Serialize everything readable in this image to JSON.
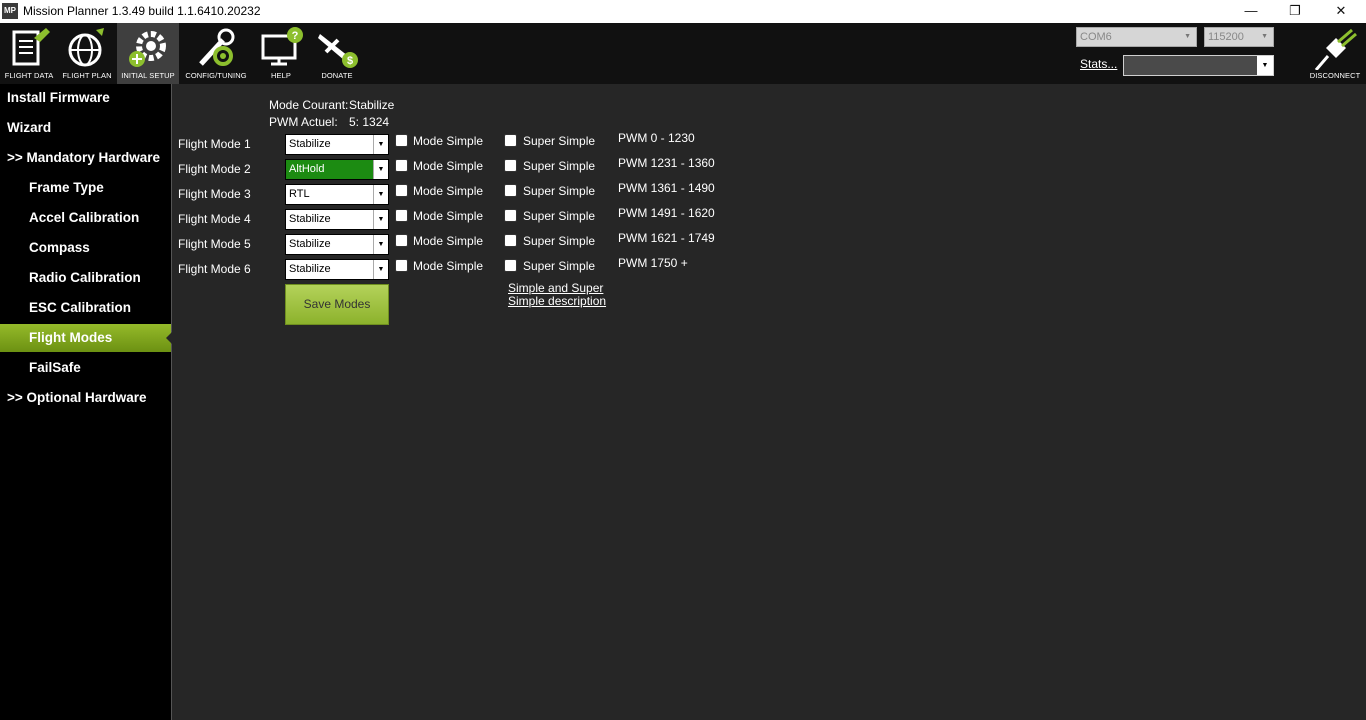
{
  "window": {
    "title": "Mission Planner 1.3.49 build 1.1.6410.20232",
    "app_icon_text": "MP",
    "minimize": "—",
    "restore": "❐",
    "close": "✕"
  },
  "toolbar": {
    "items": [
      {
        "label": "FLIGHT DATA",
        "icon": "flight-data-icon"
      },
      {
        "label": "FLIGHT PLAN",
        "icon": "flight-plan-icon"
      },
      {
        "label": "INITIAL SETUP",
        "icon": "initial-setup-icon",
        "active": true
      },
      {
        "label": "CONFIG/TUNING",
        "icon": "config-tuning-icon"
      },
      {
        "label": "HELP",
        "icon": "help-icon"
      },
      {
        "label": "DONATE",
        "icon": "donate-icon"
      }
    ],
    "port": "COM6",
    "baud": "115200",
    "stats_label": "Stats...",
    "stats_value": "",
    "disconnect_label": "DISCONNECT"
  },
  "sidebar": {
    "items": [
      {
        "label": "Install Firmware"
      },
      {
        "label": "Wizard"
      },
      {
        "label": ">> Mandatory Hardware"
      },
      {
        "label": "Frame Type"
      },
      {
        "label": "Accel Calibration"
      },
      {
        "label": "Compass"
      },
      {
        "label": "Radio Calibration"
      },
      {
        "label": "ESC Calibration"
      },
      {
        "label": "Flight Modes",
        "selected": true
      },
      {
        "label": "FailSafe"
      },
      {
        "label": ">> Optional Hardware"
      }
    ]
  },
  "main": {
    "current_mode_label": "Mode Courant:",
    "current_mode_value": "Stabilize",
    "pwm_label": "PWM Actuel:",
    "pwm_value": "5: 1324",
    "simple_label": "Mode Simple",
    "super_simple_label": "Super Simple",
    "modes": [
      {
        "label": "Flight Mode 1",
        "value": "Stabilize",
        "pwm": "PWM 0 - 1230",
        "simple": false,
        "super_simple": false
      },
      {
        "label": "Flight Mode 2",
        "value": "AltHold",
        "pwm": "PWM 1231 - 1360",
        "simple": false,
        "super_simple": false,
        "active": true
      },
      {
        "label": "Flight Mode 3",
        "value": "RTL",
        "pwm": "PWM 1361 - 1490",
        "simple": false,
        "super_simple": false
      },
      {
        "label": "Flight Mode 4",
        "value": "Stabilize",
        "pwm": "PWM 1491 - 1620",
        "simple": false,
        "super_simple": false
      },
      {
        "label": "Flight Mode 5",
        "value": "Stabilize",
        "pwm": "PWM 1621 - 1749",
        "simple": false,
        "super_simple": false
      },
      {
        "label": "Flight Mode 6",
        "value": "Stabilize",
        "pwm": "PWM 1750 +",
        "simple": false,
        "super_simple": false
      }
    ],
    "save_button": "Save Modes",
    "description_link_line1": "Simple and Super",
    "description_link_line2": "Simple description"
  }
}
